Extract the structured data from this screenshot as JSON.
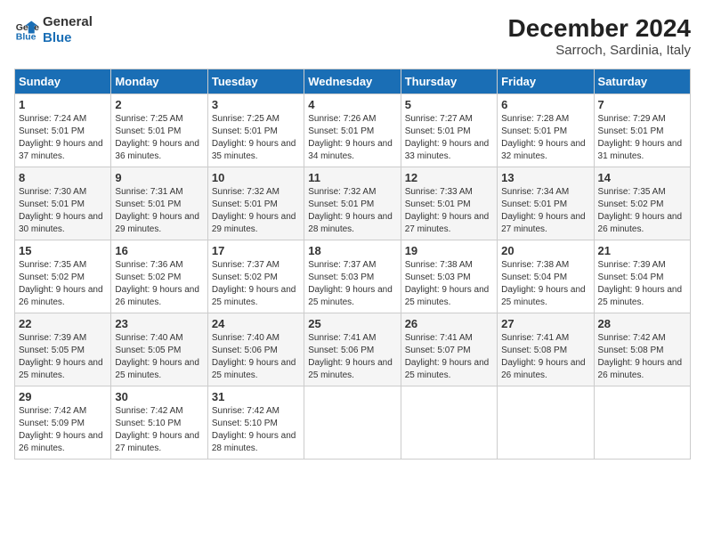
{
  "logo": {
    "line1": "General",
    "line2": "Blue"
  },
  "title": "December 2024",
  "subtitle": "Sarroch, Sardinia, Italy",
  "weekdays": [
    "Sunday",
    "Monday",
    "Tuesday",
    "Wednesday",
    "Thursday",
    "Friday",
    "Saturday"
  ],
  "weeks": [
    [
      {
        "day": "1",
        "sunrise": "7:24 AM",
        "sunset": "5:01 PM",
        "daylight": "9 hours and 37 minutes."
      },
      {
        "day": "2",
        "sunrise": "7:25 AM",
        "sunset": "5:01 PM",
        "daylight": "9 hours and 36 minutes."
      },
      {
        "day": "3",
        "sunrise": "7:25 AM",
        "sunset": "5:01 PM",
        "daylight": "9 hours and 35 minutes."
      },
      {
        "day": "4",
        "sunrise": "7:26 AM",
        "sunset": "5:01 PM",
        "daylight": "9 hours and 34 minutes."
      },
      {
        "day": "5",
        "sunrise": "7:27 AM",
        "sunset": "5:01 PM",
        "daylight": "9 hours and 33 minutes."
      },
      {
        "day": "6",
        "sunrise": "7:28 AM",
        "sunset": "5:01 PM",
        "daylight": "9 hours and 32 minutes."
      },
      {
        "day": "7",
        "sunrise": "7:29 AM",
        "sunset": "5:01 PM",
        "daylight": "9 hours and 31 minutes."
      }
    ],
    [
      {
        "day": "8",
        "sunrise": "7:30 AM",
        "sunset": "5:01 PM",
        "daylight": "9 hours and 30 minutes."
      },
      {
        "day": "9",
        "sunrise": "7:31 AM",
        "sunset": "5:01 PM",
        "daylight": "9 hours and 29 minutes."
      },
      {
        "day": "10",
        "sunrise": "7:32 AM",
        "sunset": "5:01 PM",
        "daylight": "9 hours and 29 minutes."
      },
      {
        "day": "11",
        "sunrise": "7:32 AM",
        "sunset": "5:01 PM",
        "daylight": "9 hours and 28 minutes."
      },
      {
        "day": "12",
        "sunrise": "7:33 AM",
        "sunset": "5:01 PM",
        "daylight": "9 hours and 27 minutes."
      },
      {
        "day": "13",
        "sunrise": "7:34 AM",
        "sunset": "5:01 PM",
        "daylight": "9 hours and 27 minutes."
      },
      {
        "day": "14",
        "sunrise": "7:35 AM",
        "sunset": "5:02 PM",
        "daylight": "9 hours and 26 minutes."
      }
    ],
    [
      {
        "day": "15",
        "sunrise": "7:35 AM",
        "sunset": "5:02 PM",
        "daylight": "9 hours and 26 minutes."
      },
      {
        "day": "16",
        "sunrise": "7:36 AM",
        "sunset": "5:02 PM",
        "daylight": "9 hours and 26 minutes."
      },
      {
        "day": "17",
        "sunrise": "7:37 AM",
        "sunset": "5:02 PM",
        "daylight": "9 hours and 25 minutes."
      },
      {
        "day": "18",
        "sunrise": "7:37 AM",
        "sunset": "5:03 PM",
        "daylight": "9 hours and 25 minutes."
      },
      {
        "day": "19",
        "sunrise": "7:38 AM",
        "sunset": "5:03 PM",
        "daylight": "9 hours and 25 minutes."
      },
      {
        "day": "20",
        "sunrise": "7:38 AM",
        "sunset": "5:04 PM",
        "daylight": "9 hours and 25 minutes."
      },
      {
        "day": "21",
        "sunrise": "7:39 AM",
        "sunset": "5:04 PM",
        "daylight": "9 hours and 25 minutes."
      }
    ],
    [
      {
        "day": "22",
        "sunrise": "7:39 AM",
        "sunset": "5:05 PM",
        "daylight": "9 hours and 25 minutes."
      },
      {
        "day": "23",
        "sunrise": "7:40 AM",
        "sunset": "5:05 PM",
        "daylight": "9 hours and 25 minutes."
      },
      {
        "day": "24",
        "sunrise": "7:40 AM",
        "sunset": "5:06 PM",
        "daylight": "9 hours and 25 minutes."
      },
      {
        "day": "25",
        "sunrise": "7:41 AM",
        "sunset": "5:06 PM",
        "daylight": "9 hours and 25 minutes."
      },
      {
        "day": "26",
        "sunrise": "7:41 AM",
        "sunset": "5:07 PM",
        "daylight": "9 hours and 25 minutes."
      },
      {
        "day": "27",
        "sunrise": "7:41 AM",
        "sunset": "5:08 PM",
        "daylight": "9 hours and 26 minutes."
      },
      {
        "day": "28",
        "sunrise": "7:42 AM",
        "sunset": "5:08 PM",
        "daylight": "9 hours and 26 minutes."
      }
    ],
    [
      {
        "day": "29",
        "sunrise": "7:42 AM",
        "sunset": "5:09 PM",
        "daylight": "9 hours and 26 minutes."
      },
      {
        "day": "30",
        "sunrise": "7:42 AM",
        "sunset": "5:10 PM",
        "daylight": "9 hours and 27 minutes."
      },
      {
        "day": "31",
        "sunrise": "7:42 AM",
        "sunset": "5:10 PM",
        "daylight": "9 hours and 28 minutes."
      },
      null,
      null,
      null,
      null
    ]
  ]
}
